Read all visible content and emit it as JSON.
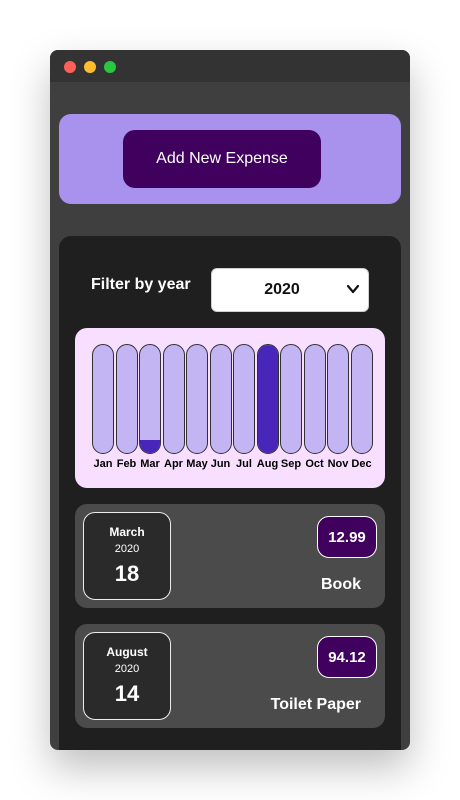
{
  "new_expense": {
    "button_label": "Add New Expense"
  },
  "filter": {
    "label": "Filter by year",
    "selected_year": "2020"
  },
  "chart": {
    "bar_color": "#c3b4f3",
    "fill_color": "#4826b9",
    "months": [
      {
        "label": "Jan",
        "fill": 0
      },
      {
        "label": "Feb",
        "fill": 0
      },
      {
        "label": "Mar",
        "fill": 0.12
      },
      {
        "label": "Apr",
        "fill": 0
      },
      {
        "label": "May",
        "fill": 0
      },
      {
        "label": "Jun",
        "fill": 0
      },
      {
        "label": "Jul",
        "fill": 0
      },
      {
        "label": "Aug",
        "fill": 1
      },
      {
        "label": "Sep",
        "fill": 0
      },
      {
        "label": "Oct",
        "fill": 0
      },
      {
        "label": "Nov",
        "fill": 0
      },
      {
        "label": "Dec",
        "fill": 0
      }
    ]
  },
  "expenses": [
    {
      "month": "March",
      "year": "2020",
      "day": "18",
      "amount": "12.99",
      "title": "Book"
    },
    {
      "month": "August",
      "year": "2020",
      "day": "14",
      "amount": "94.12",
      "title": "Toilet Paper"
    }
  ]
}
